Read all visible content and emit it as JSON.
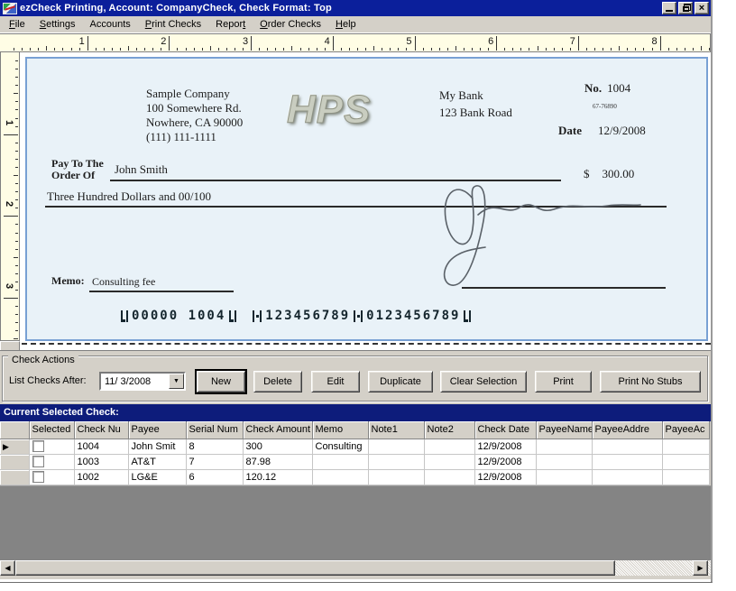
{
  "colors": {
    "titlebar": "#0b1f9b",
    "caption_bar": "#0d1c7b",
    "panel": "#d4d0c8",
    "check_background": "#e9f2f8",
    "check_border": "#78a0d4",
    "ruler": "#fffde5",
    "grid_empty": "#848484"
  },
  "window": {
    "title": "ezCheck Printing, Account: CompanyCheck, Check Format: Top"
  },
  "menu": {
    "items": [
      {
        "label": "File",
        "u": 0
      },
      {
        "label": "Settings",
        "u": 0
      },
      {
        "label": "Accounts",
        "u": -1
      },
      {
        "label": "Print Checks",
        "u": 0
      },
      {
        "label": "Report",
        "u": 5
      },
      {
        "label": "Order Checks",
        "u": 0
      },
      {
        "label": "Help",
        "u": 0
      }
    ]
  },
  "rulers": {
    "horizontal_numbers": [
      1,
      2,
      3,
      4,
      5,
      6,
      7,
      8
    ],
    "vertical_numbers": [
      1,
      2,
      3
    ]
  },
  "check": {
    "company": {
      "name": "Sample Company",
      "address1": "100 Somewhere Rd.",
      "address2": "Nowhere, CA 90000",
      "phone": "(111) 111-1111"
    },
    "logo_text": "HPS",
    "bank": {
      "name": "My Bank",
      "address": "123 Bank Road",
      "fraction": "67-76890"
    },
    "number_label": "No.",
    "number": "1004",
    "date_label": "Date",
    "date": "12/9/2008",
    "payto_label1": "Pay To The",
    "payto_label2": "Order Of",
    "payee": "John Smith",
    "dollar_sign": "$",
    "amount": "300.00",
    "amount_words": "Three Hundred  Dollars and 00/100",
    "memo_label": "Memo:",
    "memo": "Consulting fee",
    "micr": {
      "check_no": "00000 1004",
      "routing": "123456789",
      "account": "0123456789"
    }
  },
  "actions": {
    "group_label": "Check Actions",
    "list_after_label": "List Checks After:",
    "date_value": "11/ 3/2008",
    "buttons": [
      "New",
      "Delete",
      "Edit",
      "Duplicate",
      "Clear Selection",
      "Print",
      "Print No Stubs"
    ]
  },
  "grid": {
    "caption": "Current Selected Check:",
    "columns": [
      "Selected",
      "Check Nu",
      "Payee",
      "Serial Num",
      "Check Amount",
      "Memo",
      "Note1",
      "Note2",
      "Check Date",
      "PayeeName",
      "PayeeAddre",
      "PayeeAc"
    ],
    "rows": [
      {
        "current": true,
        "selected": false,
        "cells": [
          "1004",
          "John Smit",
          "8",
          "300",
          "Consulting",
          "",
          "",
          "12/9/2008",
          "",
          "",
          ""
        ]
      },
      {
        "current": false,
        "selected": false,
        "cells": [
          "1003",
          "AT&T",
          "7",
          "87.98",
          "",
          "",
          "",
          "12/9/2008",
          "",
          "",
          ""
        ]
      },
      {
        "current": false,
        "selected": false,
        "cells": [
          "1002",
          "LG&E",
          "6",
          "120.12",
          "",
          "",
          "",
          "12/9/2008",
          "",
          "",
          ""
        ]
      }
    ]
  }
}
